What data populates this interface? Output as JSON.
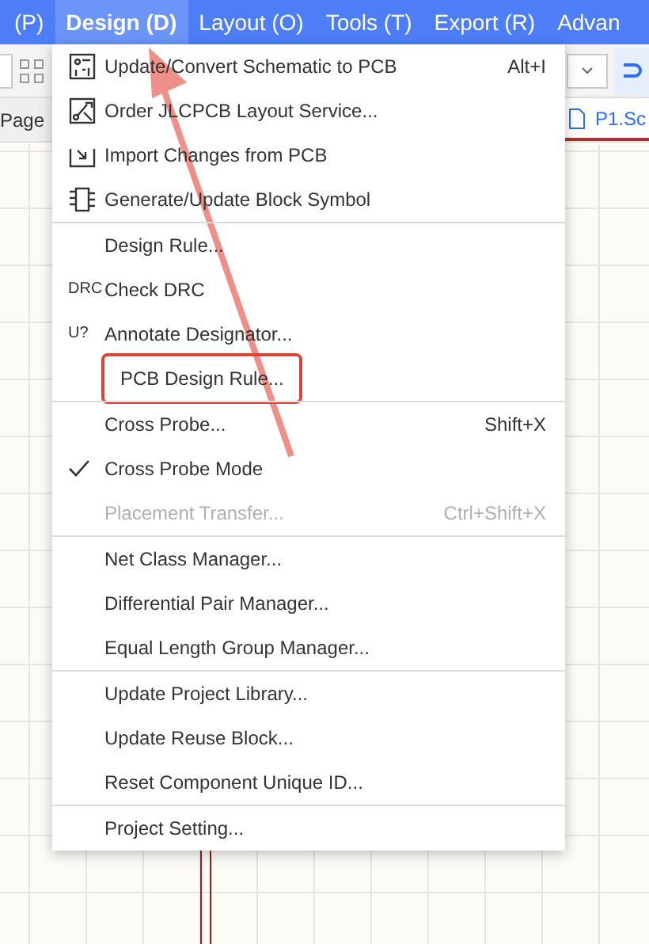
{
  "menu_bar": [
    {
      "label": "(P)",
      "selected": false
    },
    {
      "label": "Design (D)",
      "selected": true
    },
    {
      "label": "Layout (O)",
      "selected": false
    },
    {
      "label": "Tools (T)",
      "selected": false
    },
    {
      "label": "Export (R)",
      "selected": false
    },
    {
      "label": "Advan",
      "selected": false
    }
  ],
  "tabs": [
    {
      "label": "Page",
      "selected": false
    },
    {
      "label": "P1.Sc",
      "selected": true
    }
  ],
  "menu": [
    [
      {
        "kind": "icon",
        "label": "Update/Convert Schematic to PCB",
        "shortcut": "Alt+I",
        "checked": false,
        "disabled": false,
        "highlighted": false
      },
      {
        "kind": "icon",
        "label": "Order JLCPCB Layout Service...",
        "checked": false,
        "disabled": false,
        "highlighted": false
      },
      {
        "kind": "icon",
        "label": "Import Changes from PCB",
        "checked": false,
        "disabled": false,
        "highlighted": false
      },
      {
        "kind": "icon",
        "label": "Generate/Update Block Symbol",
        "checked": false,
        "disabled": false,
        "highlighted": false
      }
    ],
    [
      {
        "kind": "plain",
        "label": "Design Rule...",
        "checked": false,
        "disabled": false,
        "highlighted": false
      },
      {
        "kind": "glyph",
        "glyph": "DRC",
        "label": "Check DRC",
        "checked": false,
        "disabled": false,
        "highlighted": false
      },
      {
        "kind": "glyph",
        "glyph": "U?",
        "label": "Annotate Designator...",
        "checked": false,
        "disabled": false,
        "highlighted": false
      },
      {
        "kind": "plain",
        "label": "PCB Design Rule...",
        "checked": false,
        "disabled": false,
        "highlighted": true
      }
    ],
    [
      {
        "kind": "plain",
        "label": "Cross Probe...",
        "shortcut": "Shift+X",
        "checked": false,
        "disabled": false,
        "highlighted": false
      },
      {
        "kind": "plain",
        "label": "Cross Probe Mode",
        "checked": true,
        "disabled": false,
        "highlighted": false
      },
      {
        "kind": "plain",
        "label": "Placement Transfer...",
        "shortcut": "Ctrl+Shift+X",
        "checked": false,
        "disabled": true,
        "highlighted": false
      }
    ],
    [
      {
        "kind": "plain",
        "label": "Net Class Manager...",
        "checked": false,
        "disabled": false,
        "highlighted": false
      },
      {
        "kind": "plain",
        "label": "Differential Pair Manager...",
        "checked": false,
        "disabled": false,
        "highlighted": false
      },
      {
        "kind": "plain",
        "label": "Equal Length Group Manager...",
        "checked": false,
        "disabled": false,
        "highlighted": false
      }
    ],
    [
      {
        "kind": "plain",
        "label": "Update Project Library...",
        "checked": false,
        "disabled": false,
        "highlighted": false
      },
      {
        "kind": "plain",
        "label": "Update Reuse Block...",
        "checked": false,
        "disabled": false,
        "highlighted": false
      },
      {
        "kind": "plain",
        "label": "Reset Component Unique ID...",
        "checked": false,
        "disabled": false,
        "highlighted": false
      }
    ],
    [
      {
        "kind": "plain",
        "label": "Project Setting...",
        "checked": false,
        "disabled": false,
        "highlighted": false
      }
    ]
  ]
}
